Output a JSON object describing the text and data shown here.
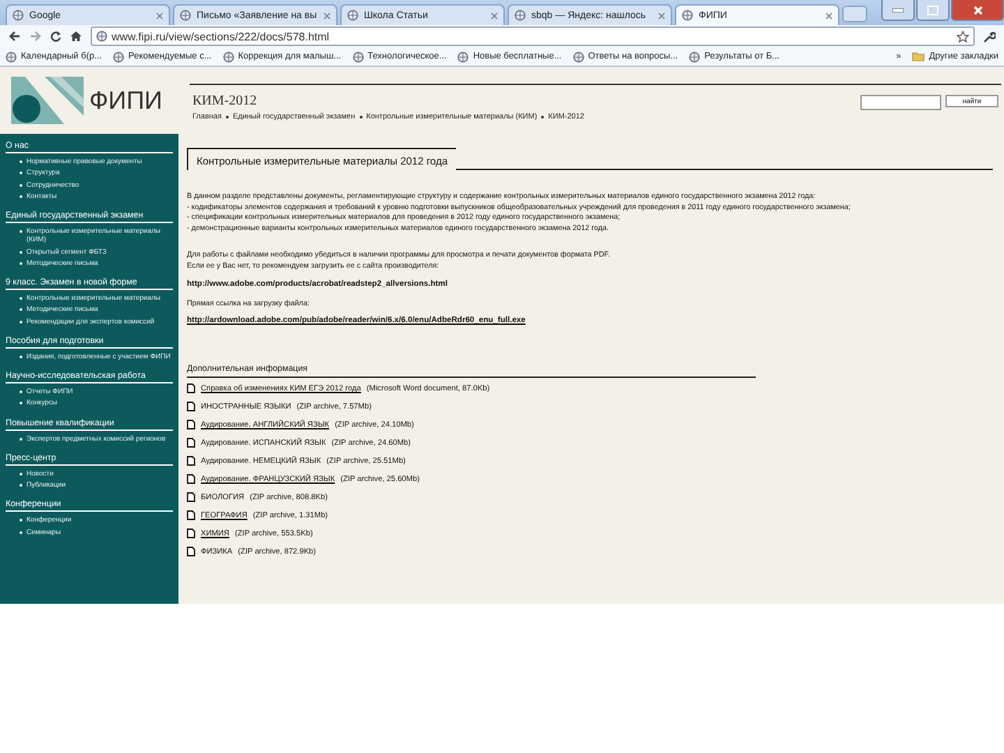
{
  "browser": {
    "tabs": [
      {
        "title": "Google",
        "selected": false
      },
      {
        "title": "Письмо «Заявление на вы",
        "selected": false
      },
      {
        "title": "Школа Статьи",
        "selected": false
      },
      {
        "title": "sbqb — Яндекс: нашлось",
        "selected": false
      },
      {
        "title": "ФИПИ",
        "selected": true
      }
    ],
    "address": "www.fipi.ru/view/sections/222/docs/578.html",
    "bookmarks": [
      "Календарный б(р...",
      "Рекомендуемые с...",
      "Коррекция для малыш...",
      "Технологическое...",
      "Новые бесплатные...",
      "Ответы на вопросы...",
      "Результаты от Б..."
    ],
    "bookmarks_more": "»",
    "other_bookmarks": "Другие закладки"
  },
  "site": {
    "logo": "ФИПИ",
    "page_title": "КИМ-2012",
    "breadcrumbs": [
      "Главная",
      "Единый государственный экзамен",
      "Контрольные измерительные материалы (КИМ)",
      "КИМ-2012"
    ],
    "search": {
      "button": "найти"
    }
  },
  "sidebar": [
    {
      "heading": "О нас",
      "items": [
        "Нормативные правовые документы",
        "Структура",
        "Сотрудничество",
        "Контакты"
      ]
    },
    {
      "heading": "Единый государственный экзамен",
      "items": [
        "Контрольные измерительные материалы (КИМ)",
        "Открытый сегмент ФБТЗ",
        "Методические письма"
      ]
    },
    {
      "heading": "9 класс. Экзамен в новой форме",
      "items": [
        "Контрольные измерительные материалы",
        "Методические письма",
        "Рекомендации для экспертов комиссий"
      ]
    },
    {
      "heading": "Пособия для подготовки",
      "items": [
        "Издания, подготовленные с участием ФИПИ"
      ]
    },
    {
      "heading": "Научно-исследовательская работа",
      "items": [
        "Отчеты ФИПИ",
        "Конкурсы"
      ]
    },
    {
      "heading": "Повышение квалификации",
      "items": [
        "Экспертов предметных комиссий регионов"
      ]
    },
    {
      "heading": "Пресс-центр",
      "items": [
        "Новости",
        "Публикации"
      ]
    },
    {
      "heading": "Конференции",
      "items": [
        "Конференции",
        "Семинары"
      ]
    }
  ],
  "content": {
    "heading": "Контрольные измерительные материалы 2012 года",
    "intro": [
      "В данном разделе представлены документы, регламентирующие структуру и содержание контрольных измерительных материалов единого государственного экзамена 2012 года:",
      "- кодификаторы элементов содержания и требований к уровню подготовки выпускников общеобразовательных учреждений для проведения в 2011 году единого государственного экзамена;",
      "- спецификации контрольных измерительных материалов для проведения в 2012 году единого государственного экзамена;",
      "- демонстрационные варианты контрольных измерительных материалов единого государственного экзамена 2012 года."
    ],
    "pdf_note": [
      "Для работы с файлами необходимо убедиться в наличии программы для просмотра и печати документов формата PDF.",
      "Если ее у Вас нет, то рекомендуем загрузить ее с сайта производителя:"
    ],
    "adobe_link": "http://www.adobe.com/products/acrobat/readstep2_allversions.html",
    "direct_label": "Прямая ссылка на загрузку файла:",
    "direct_link": "http://ardownload.adobe.com/pub/adobe/reader/win/6.x/6.0/enu/AdbeRdr60_enu_full.exe",
    "extra_heading": "Дополнительная информация",
    "files": [
      {
        "name": "Справка об изменениях КИМ ЕГЭ 2012 года",
        "info": "(Microsoft Word document, 87.0Kb)",
        "underlined": true
      },
      {
        "name": "ИНОСТРАННЫЕ ЯЗЫКИ",
        "info": "(ZIP archive, 7.57Mb)",
        "underlined": false
      },
      {
        "name": "Аудирование. АНГЛИЙСКИЙ ЯЗЫК",
        "info": "(ZIP archive, 24.10Mb)",
        "underlined": true
      },
      {
        "name": "Аудирование. ИСПАНСКИЙ ЯЗЫК",
        "info": "(ZIP archive, 24.60Mb)",
        "underlined": false
      },
      {
        "name": "Аудирование. НЕМЕЦКИЙ ЯЗЫК",
        "info": "(ZIP archive, 25.51Mb)",
        "underlined": false
      },
      {
        "name": "Аудирование. ФРАНЦУЗСКИЙ ЯЗЫК",
        "info": "(ZIP archive, 25.60Mb)",
        "underlined": true
      },
      {
        "name": "БИОЛОГИЯ",
        "info": "(ZIP archive, 808.8Kb)",
        "underlined": false
      },
      {
        "name": "ГЕОГРАФИЯ",
        "info": "(ZIP archive, 1.31Mb)",
        "underlined": true
      },
      {
        "name": "ХИМИЯ",
        "info": "(ZIP archive, 553.5Kb)",
        "underlined": true
      },
      {
        "name": "ФИЗИКА",
        "info": "(ZIP archive, 872.9Kb)",
        "underlined": false
      }
    ]
  }
}
